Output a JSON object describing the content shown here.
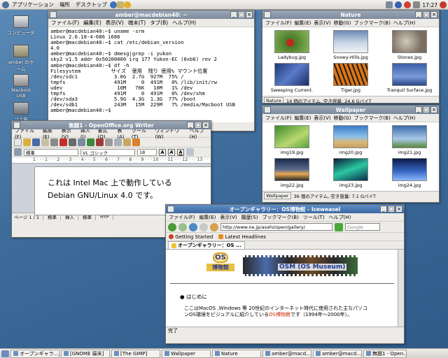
{
  "topbar": {
    "menus": [
      "アプリケーション",
      "場所",
      "デスクトップ"
    ],
    "clock": "17:27"
  },
  "desktop_icons": [
    {
      "label": "コンピュータ"
    },
    {
      "label": "amber のホーム"
    },
    {
      "label": "Macboot USB"
    },
    {
      "label": "ゴミ箱"
    }
  ],
  "terminal": {
    "title": "amber@macdebian40: ~",
    "menus": [
      "ファイル(F)",
      "編集(E)",
      "表示(V)",
      "端末(T)",
      "タブ(B)",
      "ヘルプ(H)"
    ],
    "lines": [
      "amber@macdebian40:~$ uname -srm",
      "Linux 2.6.18-4-686 i686",
      "amber@macdebian40:~$ cat /etc/debian_version",
      "4.0",
      "amber@macdebian40:~$ dmesg|grep -i yukon",
      "sky2 v1.5 addr 0x50200000 irq 177 Yukon-EC (0xb6) rev 2",
      "amber@macdebian40:~$ df -h",
      "Filesystem          サイズ  使用  残り 使用% マウント位置",
      "/dev/sdc1            3.0G  2.7G  927M  75% /",
      "tmpfs                491M     0  491M   0% /lib/init/rw",
      "udev                  10M   76K   10M   1% /dev",
      "tmpfs                491M     0  491M   0% /dev/shm",
      "/dev/sda3            5.9G  4.3G  1.3G  77% /boot",
      "/dev/sdb1            243M   15M  229M   7% /media/Macboot USB",
      "amber@macdebian40:~$"
    ]
  },
  "nature": {
    "title": "Nature",
    "menus": [
      "ファイル(F)",
      "編集(E)",
      "表示(V)",
      "移動(G)",
      "ブックマーク(B)",
      "ヘルプ(H)"
    ],
    "items": [
      {
        "name": "Ladybug.jpg"
      },
      {
        "name": "Snowy-Hills.jpg"
      },
      {
        "name": "Stones.jpg"
      },
      {
        "name": "Sweeping Current."
      },
      {
        "name": "Tiger.jpg"
      },
      {
        "name": "Tranquil Surface.jpg"
      }
    ],
    "location": "Nature",
    "status": "14 個のアイテム, 空き容量: 24.6 GバイT"
  },
  "wallpaper": {
    "title": "Wallpaper",
    "menus": [
      "ファイル(F)",
      "編集(E)",
      "表示(V)",
      "移動(G)",
      "ブックマーク(B)",
      "ヘルプ(H)"
    ],
    "items": [
      {
        "name": "img19.jpg"
      },
      {
        "name": "img20.jpg"
      },
      {
        "name": "img21.jpg"
      },
      {
        "name": "img22.jpg"
      },
      {
        "name": "img23.jpg"
      },
      {
        "name": "img24.jpg"
      }
    ],
    "location": "Wallpaper",
    "status": "36 個のアイテム, 空き容量: 7.1 GバイT"
  },
  "writer": {
    "title": "無題1 - OpenOffice.org Writer",
    "menus": [
      "ファイル(F)",
      "編集(E)",
      "表示(V)",
      "挿入(I)",
      "書式(O)",
      "表(A)",
      "ツール(T)",
      "ウィンドウ(W)",
      "ヘルプ(H)"
    ],
    "style": "標準",
    "font": "VL ゴシック",
    "size": "18",
    "ruler": "1 · · · 1 · · · 2 · · · 3 · · · 4 · · · 5 · · · 6 · · · 7 · · · 8 · · · 9 · · · 10 · · · 11 · · · 12 · · · 13 · · · 14 · · ·",
    "text_line1": "これは Intel Mac 上で動作している",
    "text_line2": "Debian GNU/Linux 4.0 です。",
    "status_page": "ページ 1 / 1",
    "status_style": "標準",
    "status_insert": "挿入",
    "status_std": "標準",
    "status_hyp": "HYP"
  },
  "firefox": {
    "title": "オープンギャラリー：OS博物館 - Iceweasel",
    "menus": [
      "ファイル(F)",
      "編集(E)",
      "表示(V)",
      "履歴(S)",
      "ブックマーク(B)",
      "ツール(T)",
      "ヘルプ(H)"
    ],
    "url": "http://www.ne.jp/asahi/open/gallery/",
    "search_placeholder": "Google",
    "bookmarks": [
      "Getting Started",
      "Latest Headlines"
    ],
    "tab_label": "オープンギャラリー：OS ...",
    "logo_os": "OS",
    "logo_museum": "博物館",
    "logo_title": "OSM (OS Museum)",
    "bullet": "はじめに",
    "body_text1": "ここはMacOS ,Windows 等 20世紀のインターネット時代に使用された主なパソコ",
    "body_text2a": "ンOS環境をビジュアルに紹介している",
    "body_link": "OS博物館",
    "body_text2b": "です（1994年～2000年）。",
    "status": "完了",
    "accent": "#cc2200"
  },
  "taskbar": [
    {
      "label": "オープンギャラ..."
    },
    {
      "label": "[GNOME 端末]"
    },
    {
      "label": "[The GIMP]"
    },
    {
      "label": "Wallpaper"
    },
    {
      "label": "Nature"
    },
    {
      "label": "amber@macd..."
    },
    {
      "label": "amber@macd..."
    },
    {
      "label": "無題1 - Open..."
    }
  ]
}
